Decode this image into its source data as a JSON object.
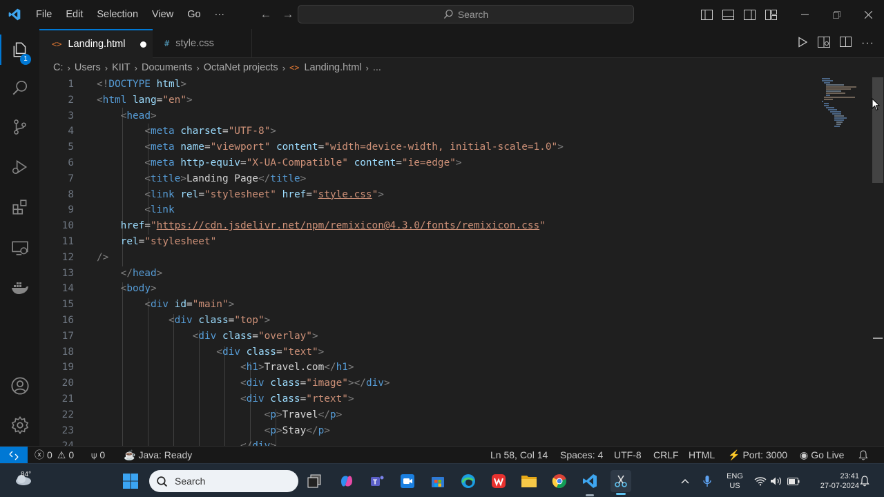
{
  "menu": [
    "File",
    "Edit",
    "Selection",
    "View",
    "Go",
    "···"
  ],
  "search_label": "Search",
  "activity_badge": "1",
  "tabs": [
    {
      "label": "Landing.html",
      "icon": "<>",
      "icon_color": "#e37933",
      "modified": true,
      "active": true
    },
    {
      "label": "style.css",
      "icon": "#",
      "icon_color": "#519aba",
      "modified": false,
      "active": false
    }
  ],
  "breadcrumb": [
    "C:",
    "Users",
    "KIIT",
    "Documents",
    "OctaNet projects",
    "Landing.html",
    "..."
  ],
  "code_lines": [
    [
      [
        "tg",
        "<!"
      ],
      [
        "dt",
        "DOCTYPE"
      ],
      [
        "tx",
        " "
      ],
      [
        "at",
        "html"
      ],
      [
        "tg",
        ">"
      ]
    ],
    [
      [
        "tg",
        "<"
      ],
      [
        "tn",
        "html"
      ],
      [
        "tx",
        " "
      ],
      [
        "at",
        "lang"
      ],
      [
        "tx",
        "="
      ],
      [
        "st",
        "\"en\""
      ],
      [
        "tg",
        ">"
      ]
    ],
    [
      [
        "tx",
        "    "
      ],
      [
        "tg",
        "<"
      ],
      [
        "tn",
        "head"
      ],
      [
        "tg",
        ">"
      ]
    ],
    [
      [
        "tx",
        "        "
      ],
      [
        "tg",
        "<"
      ],
      [
        "tn",
        "meta"
      ],
      [
        "tx",
        " "
      ],
      [
        "at",
        "charset"
      ],
      [
        "tx",
        "="
      ],
      [
        "st",
        "\"UTF-8\""
      ],
      [
        "tg",
        ">"
      ]
    ],
    [
      [
        "tx",
        "        "
      ],
      [
        "tg",
        "<"
      ],
      [
        "tn",
        "meta"
      ],
      [
        "tx",
        " "
      ],
      [
        "at",
        "name"
      ],
      [
        "tx",
        "="
      ],
      [
        "st",
        "\"viewport\""
      ],
      [
        "tx",
        " "
      ],
      [
        "at",
        "content"
      ],
      [
        "tx",
        "="
      ],
      [
        "st",
        "\"width=device-width, initial-scale=1.0\""
      ],
      [
        "tg",
        ">"
      ]
    ],
    [
      [
        "tx",
        "        "
      ],
      [
        "tg",
        "<"
      ],
      [
        "tn",
        "meta"
      ],
      [
        "tx",
        " "
      ],
      [
        "at",
        "http-equiv"
      ],
      [
        "tx",
        "="
      ],
      [
        "st",
        "\"X-UA-Compatible\""
      ],
      [
        "tx",
        " "
      ],
      [
        "at",
        "content"
      ],
      [
        "tx",
        "="
      ],
      [
        "st",
        "\"ie=edge\""
      ],
      [
        "tg",
        ">"
      ]
    ],
    [
      [
        "tx",
        "        "
      ],
      [
        "tg",
        "<"
      ],
      [
        "tn",
        "title"
      ],
      [
        "tg",
        ">"
      ],
      [
        "tx",
        "Landing Page"
      ],
      [
        "tg",
        "</"
      ],
      [
        "tn",
        "title"
      ],
      [
        "tg",
        ">"
      ]
    ],
    [
      [
        "tx",
        "        "
      ],
      [
        "tg",
        "<"
      ],
      [
        "tn",
        "link"
      ],
      [
        "tx",
        " "
      ],
      [
        "at",
        "rel"
      ],
      [
        "tx",
        "="
      ],
      [
        "st",
        "\"stylesheet\""
      ],
      [
        "tx",
        " "
      ],
      [
        "at",
        "href"
      ],
      [
        "tx",
        "="
      ],
      [
        "st",
        "\""
      ],
      [
        "stu",
        "style.css"
      ],
      [
        "st",
        "\""
      ],
      [
        "tg",
        ">"
      ]
    ],
    [
      [
        "tx",
        "        "
      ],
      [
        "tg",
        "<"
      ],
      [
        "tn",
        "link"
      ]
    ],
    [
      [
        "tx",
        "    "
      ],
      [
        "at",
        "href"
      ],
      [
        "tx",
        "="
      ],
      [
        "st",
        "\""
      ],
      [
        "stu",
        "https://cdn.jsdelivr.net/npm/remixicon@4.3.0/fonts/remixicon.css"
      ],
      [
        "st",
        "\""
      ]
    ],
    [
      [
        "tx",
        "    "
      ],
      [
        "at",
        "rel"
      ],
      [
        "tx",
        "="
      ],
      [
        "st",
        "\"stylesheet\""
      ]
    ],
    [
      [
        "tg",
        "/>"
      ]
    ],
    [
      [
        "tx",
        "    "
      ],
      [
        "tg",
        "</"
      ],
      [
        "tn",
        "head"
      ],
      [
        "tg",
        ">"
      ]
    ],
    [
      [
        "tx",
        "    "
      ],
      [
        "tg",
        "<"
      ],
      [
        "tn",
        "body"
      ],
      [
        "tg",
        ">"
      ]
    ],
    [
      [
        "tx",
        "        "
      ],
      [
        "tg",
        "<"
      ],
      [
        "tn",
        "div"
      ],
      [
        "tx",
        " "
      ],
      [
        "at",
        "id"
      ],
      [
        "tx",
        "="
      ],
      [
        "st",
        "\"main\""
      ],
      [
        "tg",
        ">"
      ]
    ],
    [
      [
        "tx",
        "            "
      ],
      [
        "tg",
        "<"
      ],
      [
        "tn",
        "div"
      ],
      [
        "tx",
        " "
      ],
      [
        "at",
        "class"
      ],
      [
        "tx",
        "="
      ],
      [
        "st",
        "\"top\""
      ],
      [
        "tg",
        ">"
      ]
    ],
    [
      [
        "tx",
        "                "
      ],
      [
        "tg",
        "<"
      ],
      [
        "tn",
        "div"
      ],
      [
        "tx",
        " "
      ],
      [
        "at",
        "class"
      ],
      [
        "tx",
        "="
      ],
      [
        "st",
        "\"overlay\""
      ],
      [
        "tg",
        ">"
      ]
    ],
    [
      [
        "tx",
        "                    "
      ],
      [
        "tg",
        "<"
      ],
      [
        "tn",
        "div"
      ],
      [
        "tx",
        " "
      ],
      [
        "at",
        "class"
      ],
      [
        "tx",
        "="
      ],
      [
        "st",
        "\"text\""
      ],
      [
        "tg",
        ">"
      ]
    ],
    [
      [
        "tx",
        "                        "
      ],
      [
        "tg",
        "<"
      ],
      [
        "tn",
        "h1"
      ],
      [
        "tg",
        ">"
      ],
      [
        "tx",
        "Travel.com"
      ],
      [
        "tg",
        "</"
      ],
      [
        "tn",
        "h1"
      ],
      [
        "tg",
        ">"
      ]
    ],
    [
      [
        "tx",
        "                        "
      ],
      [
        "tg",
        "<"
      ],
      [
        "tn",
        "div"
      ],
      [
        "tx",
        " "
      ],
      [
        "at",
        "class"
      ],
      [
        "tx",
        "="
      ],
      [
        "st",
        "\"image\""
      ],
      [
        "tg",
        "></"
      ],
      [
        "tn",
        "div"
      ],
      [
        "tg",
        ">"
      ]
    ],
    [
      [
        "tx",
        "                        "
      ],
      [
        "tg",
        "<"
      ],
      [
        "tn",
        "div"
      ],
      [
        "tx",
        " "
      ],
      [
        "at",
        "class"
      ],
      [
        "tx",
        "="
      ],
      [
        "st",
        "\"rtext\""
      ],
      [
        "tg",
        ">"
      ]
    ],
    [
      [
        "tx",
        "                            "
      ],
      [
        "tg",
        "<"
      ],
      [
        "tn",
        "p"
      ],
      [
        "tg",
        ">"
      ],
      [
        "tx",
        "Travel"
      ],
      [
        "tg",
        "</"
      ],
      [
        "tn",
        "p"
      ],
      [
        "tg",
        ">"
      ]
    ],
    [
      [
        "tx",
        "                            "
      ],
      [
        "tg",
        "<"
      ],
      [
        "tn",
        "p"
      ],
      [
        "tg",
        ">"
      ],
      [
        "tx",
        "Stay"
      ],
      [
        "tg",
        "</"
      ],
      [
        "tn",
        "p"
      ],
      [
        "tg",
        ">"
      ]
    ],
    [
      [
        "tx",
        "                        "
      ],
      [
        "tg",
        "</"
      ],
      [
        "tn",
        "div"
      ],
      [
        "tg",
        ">"
      ]
    ]
  ],
  "status": {
    "errors": "0",
    "warnings": "0",
    "ports": "0",
    "java": "Java: Ready",
    "position": "Ln 58, Col 14",
    "spaces": "Spaces: 4",
    "encoding": "UTF-8",
    "eol": "CRLF",
    "language": "HTML",
    "port": "Port: 3000",
    "golive": "Go Live"
  },
  "taskbar": {
    "weather": "84°",
    "search": "Search",
    "lang_line1": "ENG",
    "lang_line2": "US",
    "time": "23:41",
    "date": "27-07-2024"
  },
  "colors": {
    "accent": "#0078d4",
    "editor_bg": "#1f1f1f",
    "chrome_bg": "#181818"
  }
}
